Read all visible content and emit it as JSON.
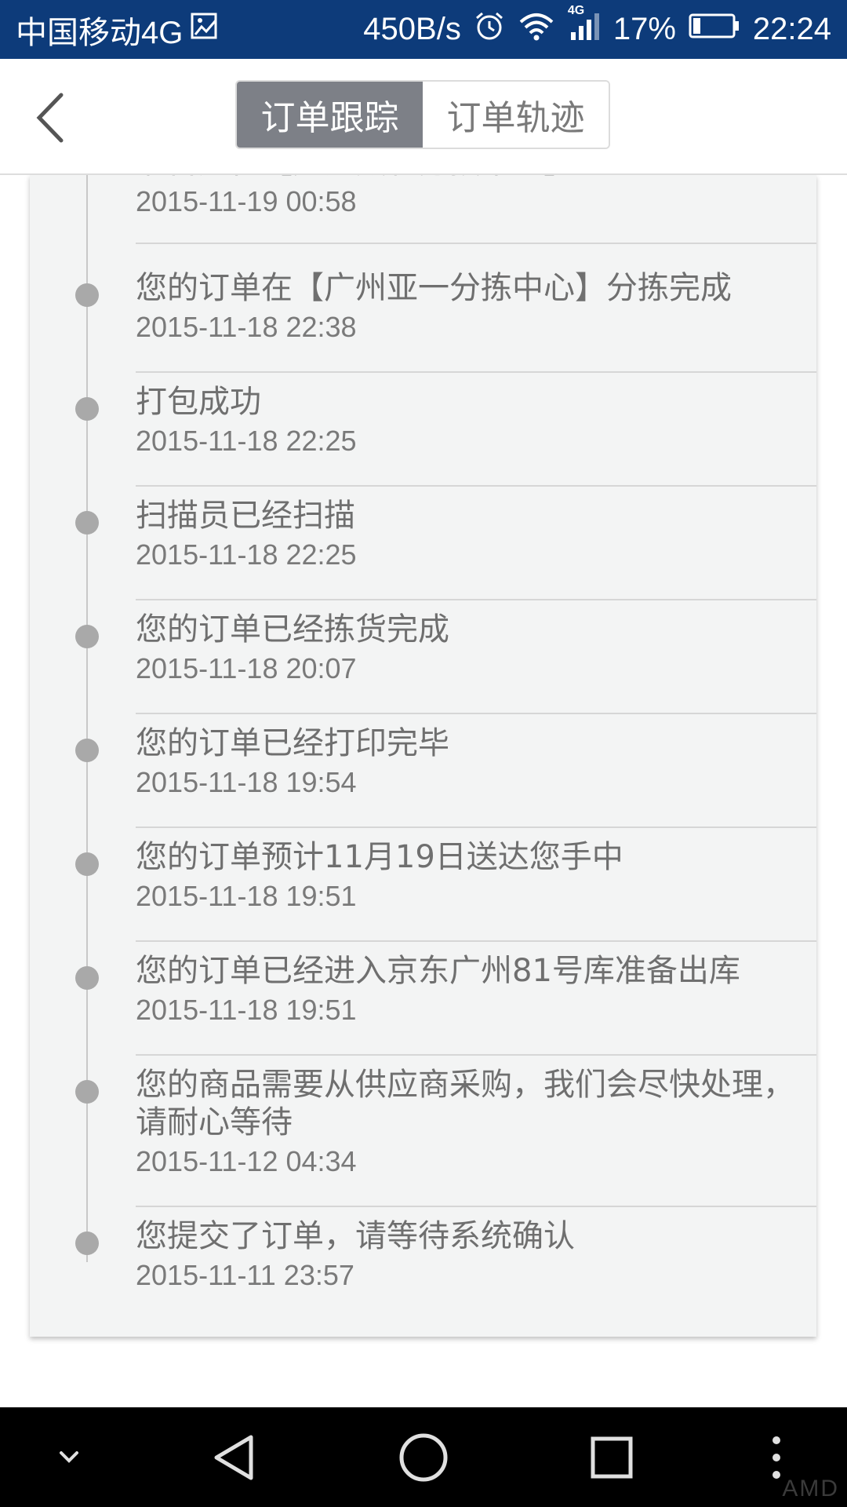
{
  "status_bar": {
    "carrier": "中国移动4G",
    "net_speed": "450B/s",
    "net_type": "4G",
    "battery": "17%",
    "time": "22:24",
    "icons": [
      "image-icon",
      "alarm-icon",
      "wifi-icon",
      "signal-icon",
      "battery-icon"
    ]
  },
  "header": {
    "back_icon": "back-arrow-icon",
    "tabs": [
      {
        "label": "订单跟踪",
        "active": true
      },
      {
        "label": "订单轨迹",
        "active": false
      }
    ]
  },
  "timeline": {
    "partial_item": {
      "desc": "准备送往【广州太和分拨中心】",
      "time": "2015-11-19  00:58"
    },
    "items": [
      {
        "desc": "您的订单在【广州亚一分拣中心】分拣完成",
        "time": "2015-11-18  22:38"
      },
      {
        "desc": "打包成功",
        "time": "2015-11-18  22:25"
      },
      {
        "desc": "扫描员已经扫描",
        "time": "2015-11-18  22:25"
      },
      {
        "desc": "您的订单已经拣货完成",
        "time": "2015-11-18  20:07"
      },
      {
        "desc": "您的订单已经打印完毕",
        "time": "2015-11-18  19:54"
      },
      {
        "desc": "您的订单预计11月19日送达您手中",
        "time": "2015-11-18  19:51"
      },
      {
        "desc": "您的订单已经进入京东广州81号库准备出库",
        "time": "2015-11-18  19:51"
      },
      {
        "desc": "您的商品需要从供应商采购，我们会尽快处理，请耐心等待",
        "time": "2015-11-12  04:34"
      },
      {
        "desc": "您提交了订单，请等待系统确认",
        "time": "2015-11-11  23:57"
      }
    ]
  },
  "nav_bar": {
    "icons": [
      "hide-keyboard-icon",
      "back-triangle-icon",
      "home-circle-icon",
      "recents-square-icon",
      "more-dots-icon"
    ],
    "watermark": "AMD"
  },
  "colors": {
    "status_bar_bg": "#0d3b7a",
    "active_tab_bg": "#7d8087",
    "card_bg": "#f3f4f4",
    "text_gray": "#6f6f6f"
  }
}
